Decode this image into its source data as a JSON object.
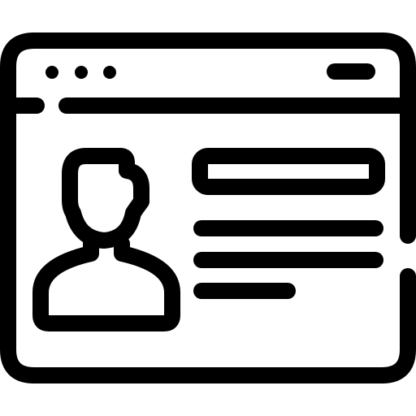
{
  "icon": {
    "name": "profile-webpage-icon",
    "stroke_color": "#000000",
    "fill_color": "#ffffff",
    "parts": {
      "window": "browser-window-icon",
      "dots": "window-control-dots-icon",
      "address_bar": "address-bar-icon",
      "avatar": "user-avatar-icon",
      "name_field": "name-field-icon",
      "text_lines": "text-lines-icon"
    }
  }
}
